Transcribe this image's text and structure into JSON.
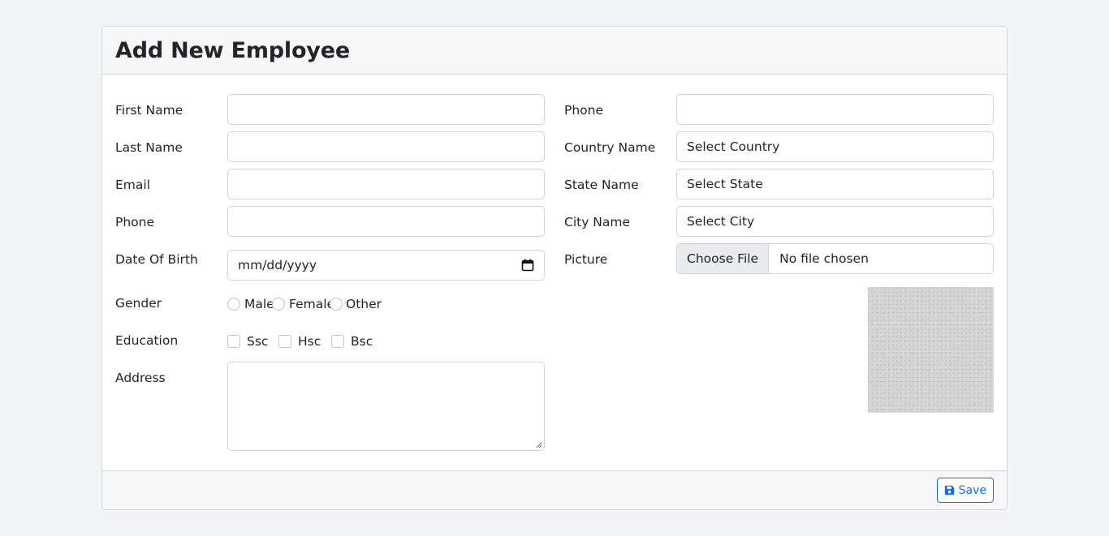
{
  "header": {
    "title": "Add New Employee"
  },
  "left": {
    "first_name": {
      "label": "First Name",
      "value": ""
    },
    "last_name": {
      "label": "Last Name",
      "value": ""
    },
    "email": {
      "label": "Email",
      "value": ""
    },
    "phone": {
      "label": "Phone",
      "value": ""
    },
    "dob": {
      "label": "Date Of Birth",
      "placeholder": "mm/dd/yyyy"
    },
    "gender": {
      "label": "Gender",
      "options": [
        "Male",
        "Female",
        "Other"
      ]
    },
    "education": {
      "label": "Education",
      "options": [
        "Ssc",
        "Hsc",
        "Bsc"
      ]
    },
    "address": {
      "label": "Address",
      "value": ""
    }
  },
  "right": {
    "phone": {
      "label": "Phone",
      "value": ""
    },
    "country": {
      "label": "Country Name",
      "selected": "Select Country"
    },
    "state": {
      "label": "State Name",
      "selected": "Select State"
    },
    "city": {
      "label": "City Name",
      "selected": "Select City"
    },
    "picture": {
      "label": "Picture",
      "button": "Choose File",
      "status": "No file chosen"
    }
  },
  "footer": {
    "save_label": "Save"
  },
  "colors": {
    "accent": "#0d6efd",
    "border": "#ced4da",
    "header_bg": "#f7f7f7",
    "page_bg": "#f3f4f8"
  },
  "icons": {
    "save": "floppy-disk-icon",
    "calendar": "calendar-icon"
  }
}
